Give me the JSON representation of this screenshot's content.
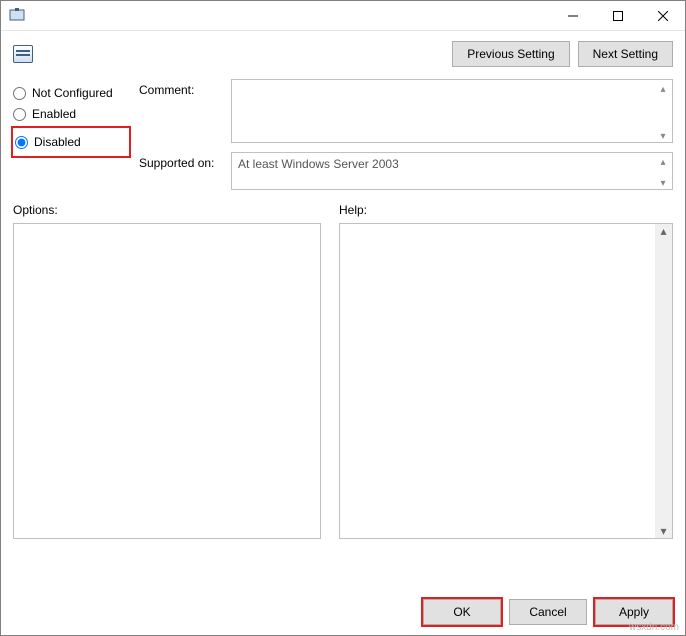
{
  "titlebar": {
    "title": ""
  },
  "nav": {
    "prev_label": "Previous Setting",
    "next_label": "Next Setting"
  },
  "state": {
    "not_configured_label": "Not Configured",
    "enabled_label": "Enabled",
    "disabled_label": "Disabled",
    "selected": "disabled"
  },
  "fields": {
    "comment_label": "Comment:",
    "comment_value": "",
    "supported_label": "Supported on:",
    "supported_value": "At least Windows Server 2003"
  },
  "panels": {
    "options_label": "Options:",
    "help_label": "Help:"
  },
  "footer": {
    "ok_label": "OK",
    "cancel_label": "Cancel",
    "apply_label": "Apply"
  },
  "watermark": "wsxdn.com"
}
